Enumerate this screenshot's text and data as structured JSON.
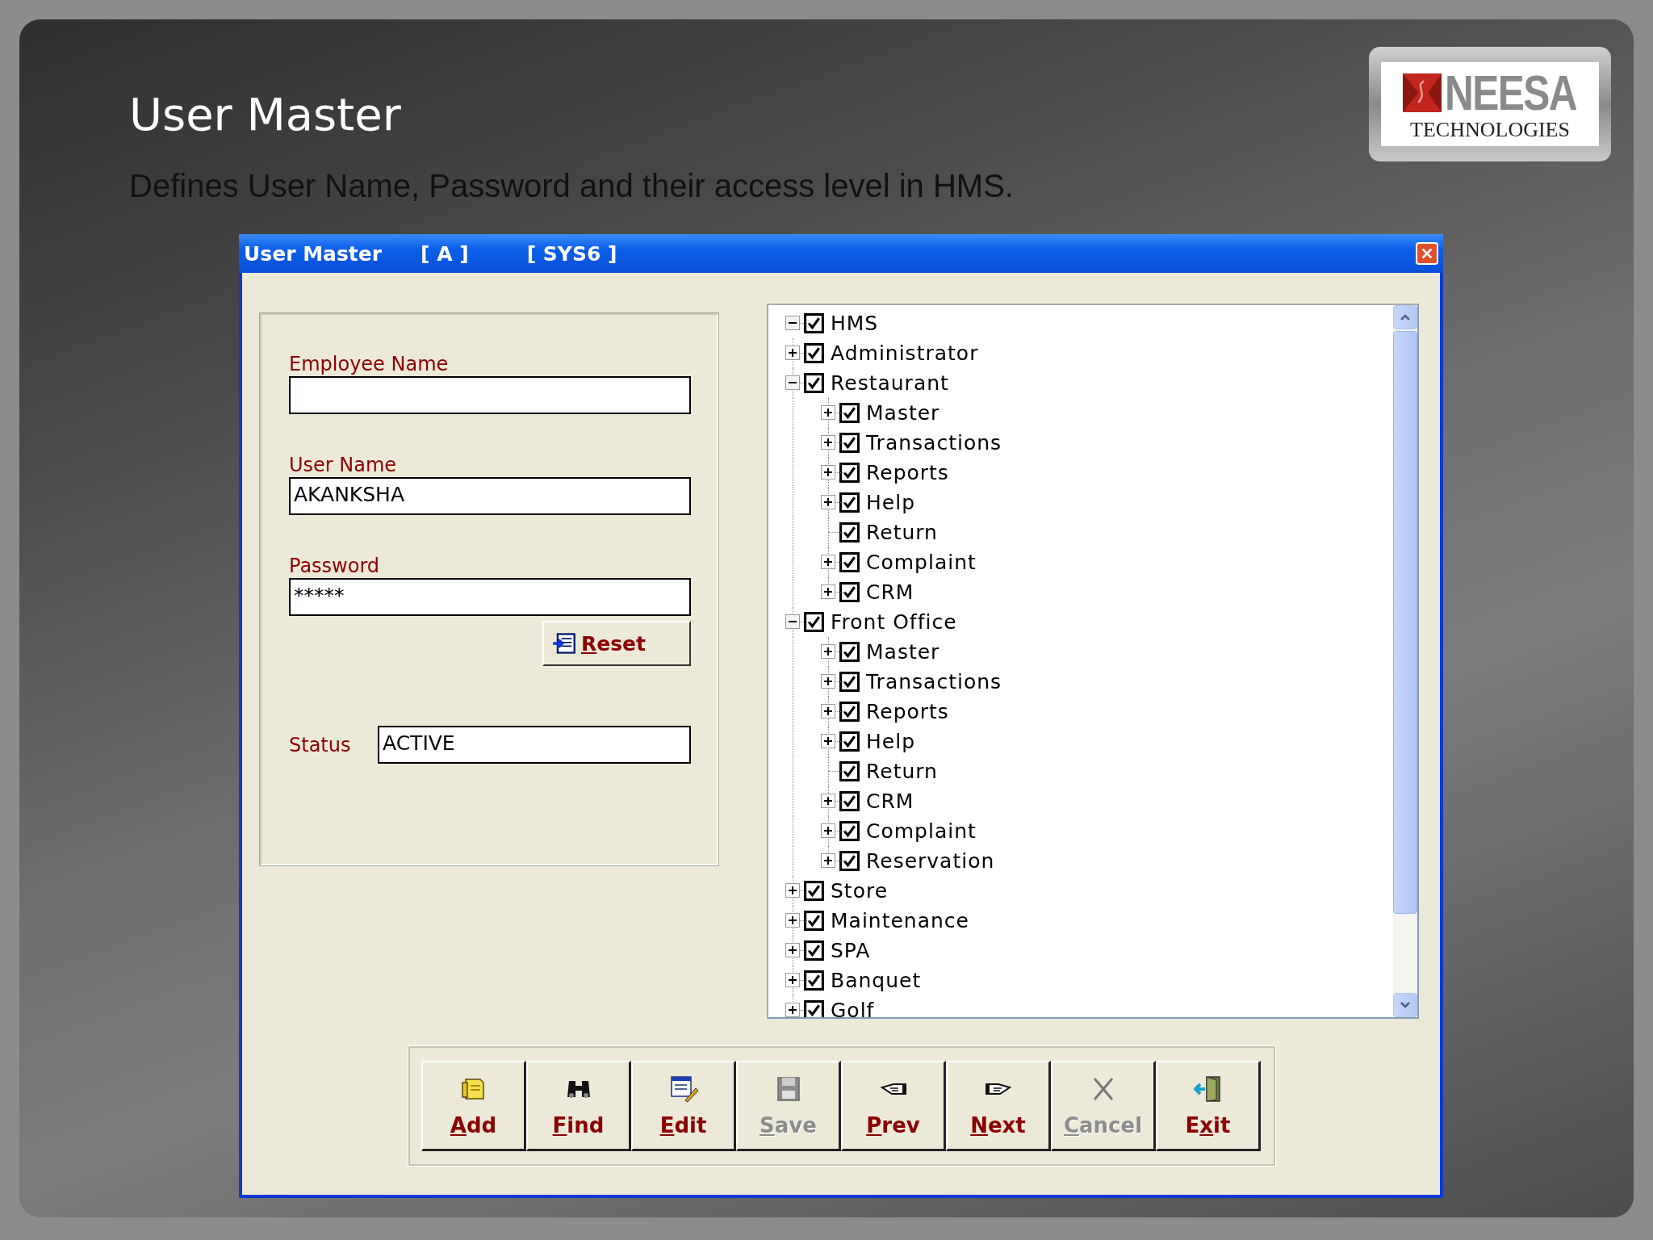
{
  "slide": {
    "title": "User Master",
    "subtitle": "Defines User Name, Password and their access level in HMS."
  },
  "logo": {
    "name": "NEESA",
    "tagline": "TECHNOLOGIES"
  },
  "window": {
    "title": "User Master",
    "mode": "[ A ]",
    "user": "[ SYS6 ]"
  },
  "form": {
    "fields": [
      {
        "label": "Employee Name"
      },
      {
        "label": "User Name",
        "value": "AKANKSHA"
      },
      {
        "label": "Password",
        "value": "*****"
      }
    ],
    "reset_button": {
      "key": "R",
      "after": "eset"
    },
    "status": {
      "label": "Status",
      "value": "ACTIVE"
    }
  },
  "tree": {
    "nodes": [
      {
        "label": "HMS",
        "checked": true,
        "expandable": true,
        "expanded": true,
        "children": [
          {
            "label": "Administrator",
            "checked": true,
            "expandable": true,
            "expanded": false
          },
          {
            "label": "Restaurant",
            "checked": true,
            "expandable": true,
            "expanded": true,
            "children": [
              {
                "label": "Master",
                "checked": true,
                "expandable": true,
                "expanded": false
              },
              {
                "label": "Transactions",
                "checked": true,
                "expandable": true,
                "expanded": false
              },
              {
                "label": "Reports",
                "checked": true,
                "expandable": true,
                "expanded": false
              },
              {
                "label": "Help",
                "checked": true,
                "expandable": true,
                "expanded": false
              },
              {
                "label": "Return",
                "checked": true
              },
              {
                "label": "Complaint",
                "checked": true,
                "expandable": true,
                "expanded": false
              },
              {
                "label": "CRM",
                "checked": true,
                "expandable": true,
                "expanded": false
              }
            ]
          },
          {
            "label": "Front Office",
            "checked": true,
            "expandable": true,
            "expanded": true,
            "children": [
              {
                "label": "Master",
                "checked": true,
                "expandable": true,
                "expanded": false
              },
              {
                "label": "Transactions",
                "checked": true,
                "expandable": true,
                "expanded": false
              },
              {
                "label": "Reports",
                "checked": true,
                "expandable": true,
                "expanded": false
              },
              {
                "label": "Help",
                "checked": true,
                "expandable": true,
                "expanded": false
              },
              {
                "label": "Return",
                "checked": true
              },
              {
                "label": "CRM",
                "checked": true,
                "expandable": true,
                "expanded": false
              },
              {
                "label": "Complaint",
                "checked": true,
                "expandable": true,
                "expanded": false
              },
              {
                "label": "Reservation",
                "checked": true,
                "expandable": true,
                "expanded": false
              }
            ]
          },
          {
            "label": "Store",
            "checked": true,
            "expandable": true,
            "expanded": false
          },
          {
            "label": "Maintenance",
            "checked": true,
            "expandable": true,
            "expanded": false
          },
          {
            "label": "SPA",
            "checked": true,
            "expandable": true,
            "expanded": false
          },
          {
            "label": "Banquet",
            "checked": true,
            "expandable": true,
            "expanded": false
          },
          {
            "label": "Golf",
            "checked": true,
            "expandable": true,
            "expanded": false
          }
        ]
      }
    ]
  },
  "toolbar": [
    {
      "kind": "add",
      "key": "A",
      "after": "dd",
      "disabled": false
    },
    {
      "kind": "find",
      "key": "F",
      "after": "ind",
      "disabled": false
    },
    {
      "kind": "edit",
      "key": "E",
      "after": "dit",
      "disabled": false
    },
    {
      "kind": "save",
      "key": "S",
      "after": "ave",
      "disabled": true
    },
    {
      "kind": "prev",
      "key": "P",
      "after": "rev",
      "disabled": false
    },
    {
      "kind": "next",
      "key": "N",
      "after": "ext",
      "disabled": false
    },
    {
      "kind": "cancel",
      "key": "C",
      "after": "ancel",
      "disabled": true
    },
    {
      "kind": "exit",
      "before": "E",
      "key": "x",
      "after": "it",
      "disabled": false
    }
  ]
}
